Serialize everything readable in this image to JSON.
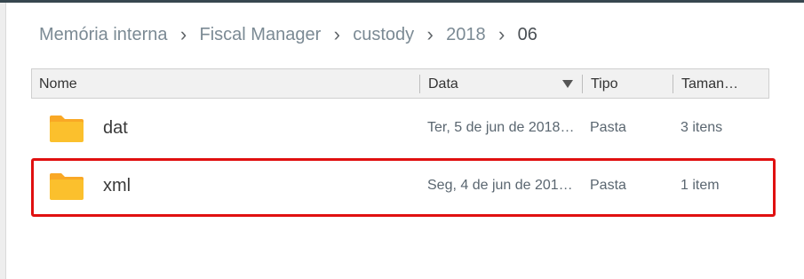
{
  "breadcrumb": [
    {
      "label": "Memória interna",
      "current": false
    },
    {
      "label": "Fiscal Manager",
      "current": false
    },
    {
      "label": "custody",
      "current": false
    },
    {
      "label": "2018",
      "current": false
    },
    {
      "label": "06",
      "current": true
    }
  ],
  "breadcrumb_separator": "›",
  "table": {
    "columns": {
      "name": "Nome",
      "date": "Data",
      "type": "Tipo",
      "size": "Taman…"
    },
    "sort": {
      "column": "date",
      "direction": "descending"
    },
    "rows": [
      {
        "name": "dat",
        "date": "Ter, 5 de jun de 2018…",
        "type": "Pasta",
        "size": "3 itens",
        "icon": "folder-icon",
        "selected": false
      },
      {
        "name": "xml",
        "date": "Seg, 4 de jun de 201…",
        "type": "Pasta",
        "size": "1 item",
        "icon": "folder-icon",
        "selected": true
      }
    ]
  },
  "colors": {
    "folder": "#fbc02d",
    "folder_tab": "#f9a825",
    "highlight": "#e01010",
    "breadcrumb_text": "#7b8a94"
  }
}
